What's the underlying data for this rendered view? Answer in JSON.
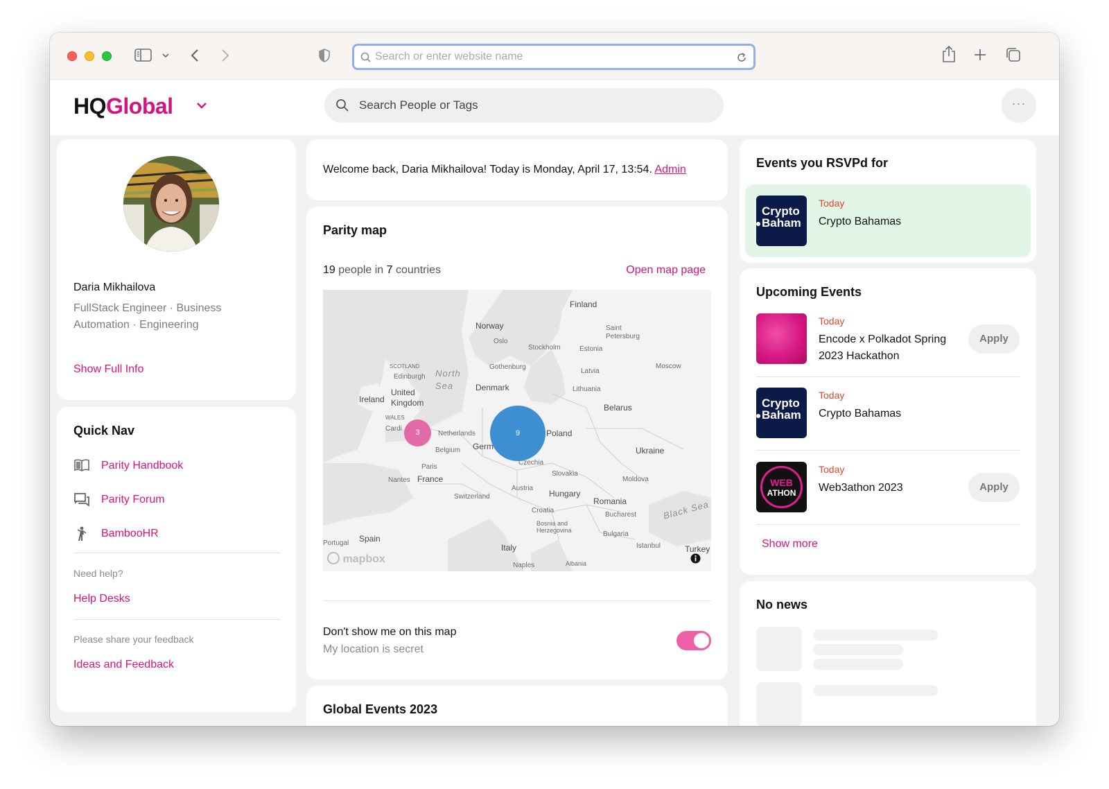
{
  "browser": {
    "address_placeholder": "Search or enter website name"
  },
  "app": {
    "logo_part1": "HQ",
    "logo_part2": "Global",
    "search_placeholder": "Search People or Tags",
    "more_label": "···"
  },
  "profile": {
    "name": "Daria Mikhailova",
    "role": "FullStack Engineer · Business Automation · Engineering",
    "show_full_info": "Show Full Info"
  },
  "quick_nav": {
    "title": "Quick Nav",
    "items": [
      {
        "label": "Parity Handbook",
        "icon": "book-icon"
      },
      {
        "label": "Parity Forum",
        "icon": "forum-icon"
      },
      {
        "label": "BambooHR",
        "icon": "person-icon"
      }
    ],
    "help_prompt": "Need help?",
    "help_link": "Help Desks",
    "feedback_prompt": "Please share your feedback",
    "feedback_link": "Ideas and Feedback"
  },
  "welcome": {
    "text": "Welcome back, Daria Mikhailova! Today is Monday, April 17, 13:54.",
    "admin_link": "Admin"
  },
  "parity_map": {
    "title": "Parity map",
    "people_count": "19",
    "people_word": "people in",
    "countries_count": "7",
    "countries_word": "countries",
    "open_link": "Open map page",
    "clusters": [
      {
        "count": "3",
        "color": "#e26aa6"
      },
      {
        "count": "9",
        "color": "#3d8fd1"
      }
    ],
    "labels": {
      "finland": "Finland",
      "norway": "Norway",
      "oslo": "Oslo",
      "stockholm": "Stockholm",
      "saint_petersburg": "Saint Petersburg",
      "estonia": "Estonia",
      "moscow": "Moscow",
      "scotland": "SCOTLAND",
      "edinburgh": "Edinburgh",
      "north_sea": "North Sea",
      "gothenburg": "Gothenburg",
      "latvia": "Latvia",
      "denmark": "Denmark",
      "united_kingdom": "United Kingdom",
      "ireland": "Ireland",
      "lithuania": "Lithuania",
      "belarus": "Belarus",
      "wales": "WALES",
      "cardiff": "Cardi",
      "netherlands": "Netherlands",
      "poland": "Poland",
      "germany": "Germ",
      "belgium": "Belgium",
      "ukraine": "Ukraine",
      "czechia": "Czechia",
      "paris": "Paris",
      "slovakia": "Slovakia",
      "moldova": "Moldova",
      "nantes": "Nantes",
      "france": "France",
      "austria": "Austria",
      "hungary": "Hungary",
      "switzerland": "Switzerland",
      "romania": "Romania",
      "croatia": "Croatia",
      "bucharest": "Bucharest",
      "black_sea": "Black Sea",
      "bosnia": "Bosnia and Herzegovina",
      "bulgaria": "Bulgaria",
      "portugal": "Portugal",
      "spain": "Spain",
      "italy": "Italy",
      "istanbul": "Istanbul",
      "turkey": "Turkey",
      "naples": "Naples",
      "albania": "Albania",
      "mapbox": "mapbox"
    },
    "hide_label": "Don't show me on this map",
    "hide_sub": "My location is secret",
    "hide_enabled": true,
    "next_section_title": "Global Events 2023"
  },
  "rsvp": {
    "title": "Events you RSVPd for",
    "events": [
      {
        "when": "Today",
        "name": "Crypto Bahamas",
        "thumb_text": "Crypto Baham"
      }
    ]
  },
  "upcoming": {
    "title": "Upcoming Events",
    "events": [
      {
        "when": "Today",
        "name": "Encode x Polkadot Spring 2023 Hackathon",
        "apply": "Apply"
      },
      {
        "when": "Today",
        "name": "Crypto Bahamas",
        "thumb_text": "Crypto Baham"
      },
      {
        "when": "Today",
        "name": "Web3athon 2023",
        "apply": "Apply",
        "thumb_text1": "WEB",
        "thumb_text2": "ATHON"
      }
    ],
    "show_more": "Show more"
  },
  "news": {
    "title": "No news"
  }
}
